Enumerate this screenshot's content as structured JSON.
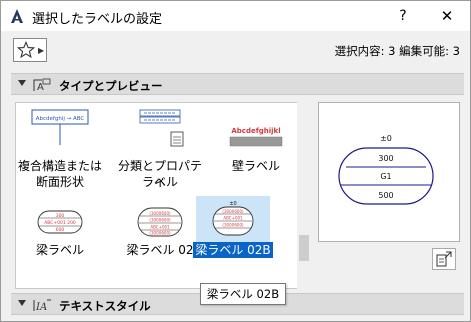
{
  "window": {
    "title": "選択したラベルの設定",
    "help_label": "?",
    "close_label": "✕"
  },
  "toolbar": {
    "selection_info": "選択内容: 3 編集可能: 3"
  },
  "sections": {
    "type_preview": {
      "label": "タイプとプレビュー"
    },
    "text_style": {
      "label": "テキストスタイル"
    }
  },
  "label_types": [
    {
      "name_line1": "複合構造または",
      "name_line2": "断面形状",
      "thumb_text": "Abcdefghij → ABC"
    },
    {
      "name_line1": "分類とプロパティ",
      "name_line2": "ラベル"
    },
    {
      "name_line1": "壁ラベル",
      "thumb_text": "Abcdefghijkl"
    },
    {
      "name_line1": "梁ラベル",
      "thumb_lines": [
        "300",
        "ABC+001 200",
        "600"
      ]
    },
    {
      "name_line1": "梁ラベル 02",
      "thumb_lines": [
        "(300X600)",
        "(300X600)",
        "ABC+001",
        "(300X600)"
      ]
    },
    {
      "name_line1": "梁ラベル 02B",
      "selected": true,
      "thumb_lines": [
        "±0",
        "(300X600)",
        "ABC+001",
        "(300X600)"
      ]
    }
  ],
  "preview": {
    "top": "±0",
    "rows": [
      "300",
      "G1",
      "500"
    ]
  },
  "tooltip": {
    "text": "梁ラベル 02B"
  },
  "colors": {
    "selection_fill": "#cce4f7",
    "selection_label": "#0a64c8",
    "thumb_red": "#d9363e",
    "thumb_blue": "#2b57b8",
    "preview_outline": "#1a1a8c"
  }
}
